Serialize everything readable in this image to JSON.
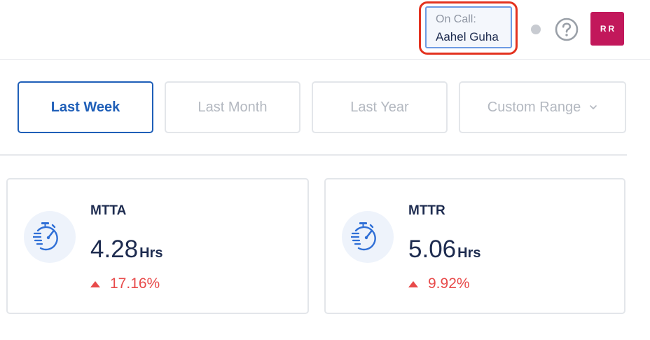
{
  "header": {
    "on_call": {
      "label": "On Call:",
      "name": "Aahel Guha"
    },
    "avatar_initials": "RR",
    "status": "offline"
  },
  "range_selector": {
    "options": [
      "Last Week",
      "Last Month",
      "Last Year",
      "Custom Range"
    ],
    "selected": "Last Week"
  },
  "metrics": [
    {
      "title": "MTTA",
      "value": "4.28",
      "unit": "Hrs",
      "change": "17.16%",
      "trend": "up"
    },
    {
      "title": "MTTR",
      "value": "5.06",
      "unit": "Hrs",
      "change": "9.92%",
      "trend": "up"
    }
  ],
  "colors": {
    "accent": "#1f5fb8",
    "highlight_ring": "#e3321f",
    "avatar_bg": "#c2185b",
    "trend_up": "#e84a4a",
    "icon": "#2f6fd6"
  },
  "icons": {
    "metric": "stopwatch-icon",
    "help": "question-circle-icon",
    "dropdown": "chevron-down-icon",
    "trend": "triangle-up-icon"
  }
}
